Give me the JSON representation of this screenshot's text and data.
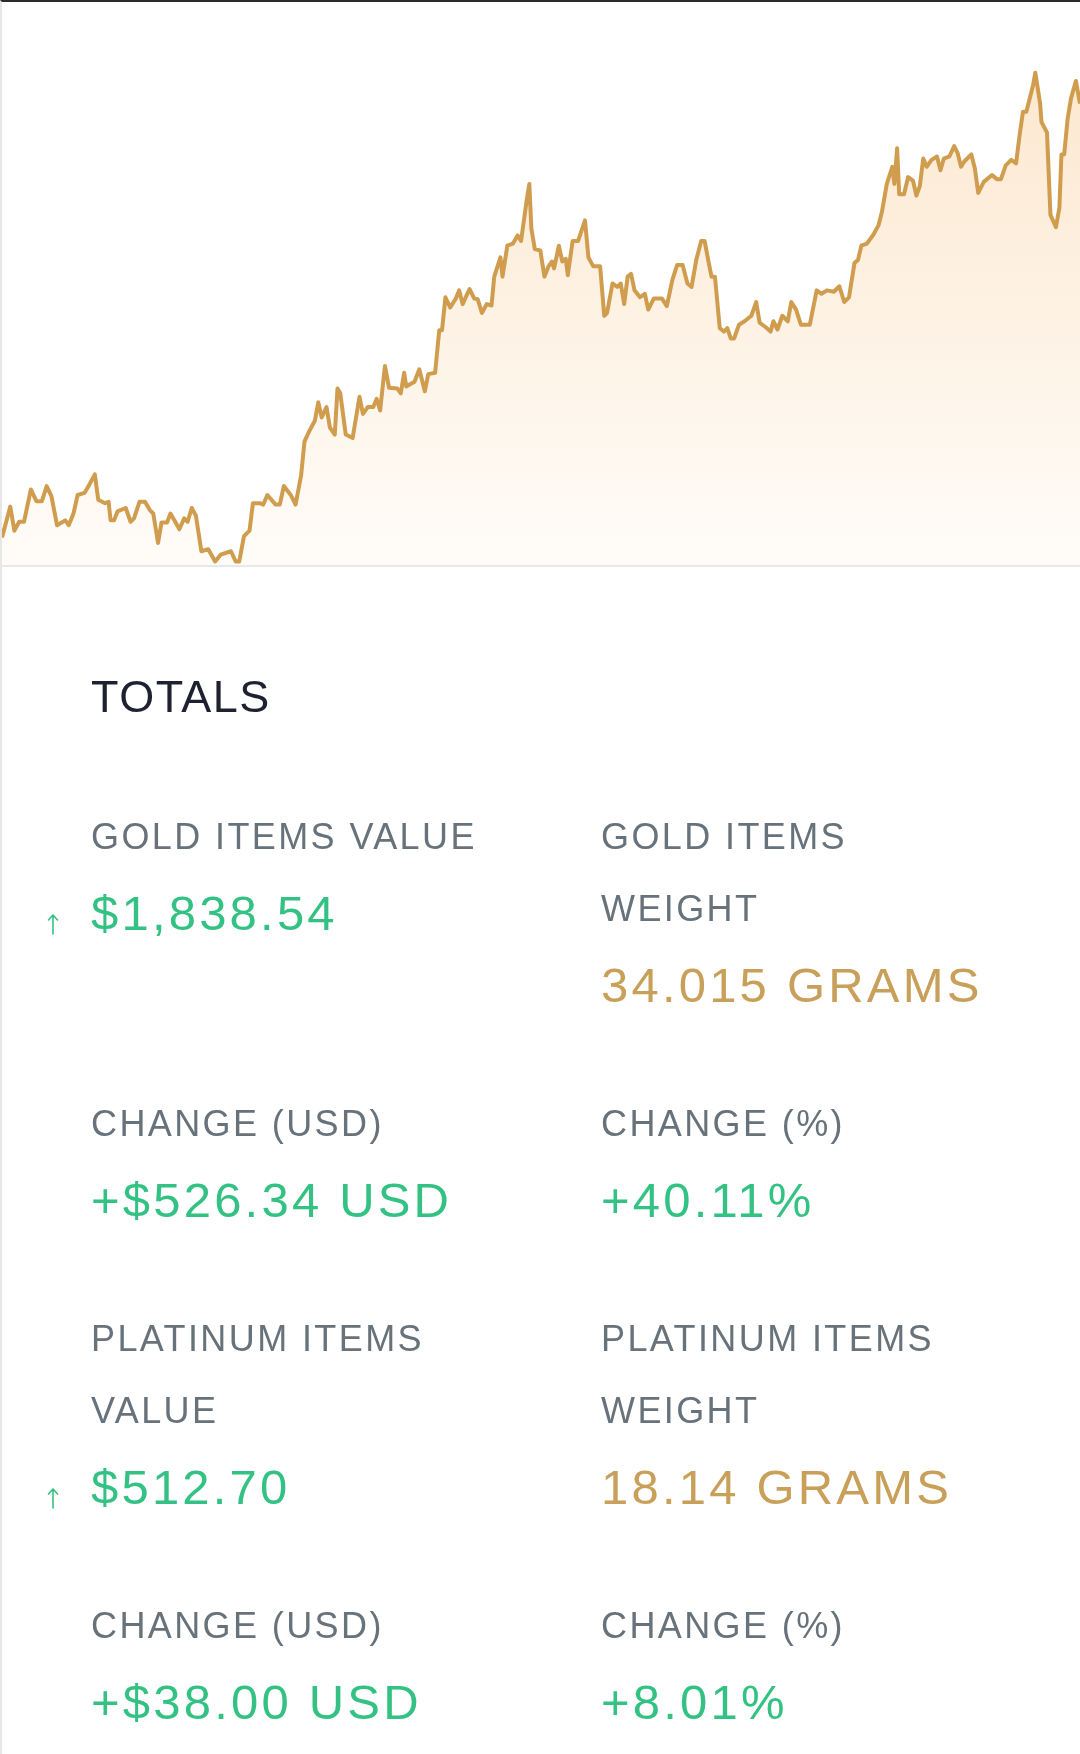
{
  "totals": {
    "title": "TOTALS",
    "stats": [
      {
        "label": "GOLD ITEMS VALUE",
        "value": "$1,838.54",
        "color": "#33c283",
        "rising": true
      },
      {
        "label": "GOLD ITEMS WEIGHT",
        "value": "34.015 GRAMS",
        "color": "#c9a05a",
        "rising": false
      },
      {
        "label": "CHANGE (USD)",
        "value": "+$526.34 USD",
        "color": "#33c283",
        "rising": false
      },
      {
        "label": "CHANGE (%)",
        "value": "+40.11%",
        "color": "#33c283",
        "rising": false
      },
      {
        "label": "PLATINUM ITEMS VALUE",
        "value": "$512.70",
        "color": "#33c283",
        "rising": true
      },
      {
        "label": "PLATINUM ITEMS WEIGHT",
        "value": "18.14 GRAMS",
        "color": "#c9a05a",
        "rising": false
      },
      {
        "label": "CHANGE (USD)",
        "value": "+$38.00 USD",
        "color": "#33c283",
        "rising": false
      },
      {
        "label": "CHANGE (%)",
        "value": "+8.01%",
        "color": "#33c283",
        "rising": false
      }
    ]
  }
}
